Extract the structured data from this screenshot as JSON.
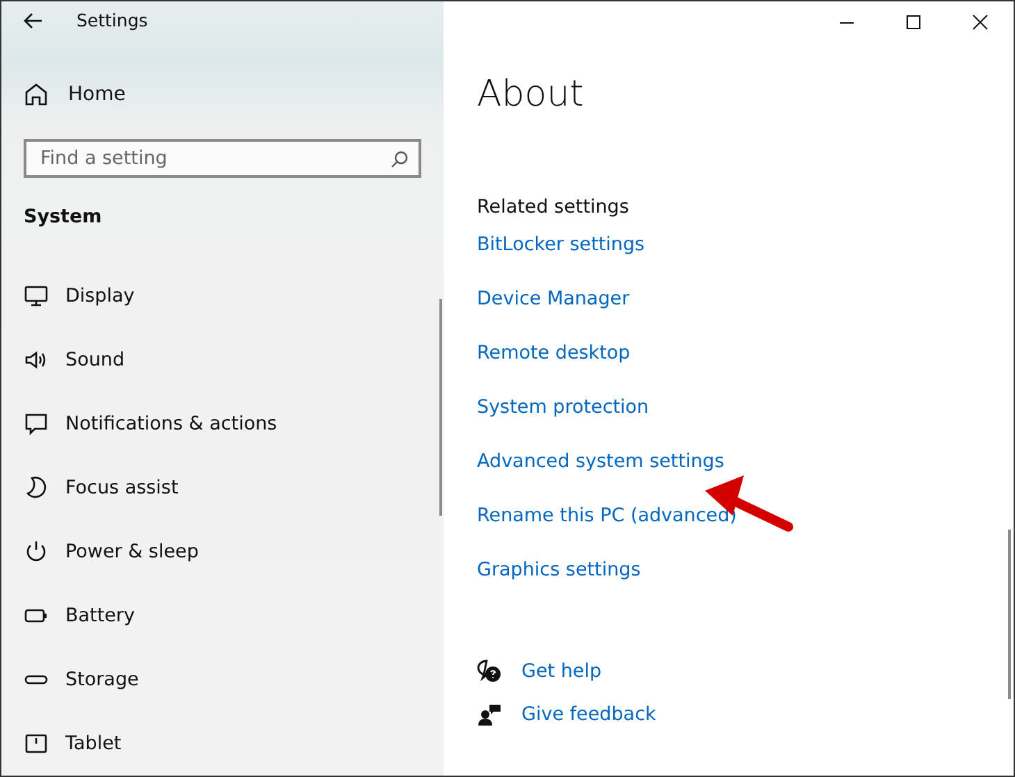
{
  "window": {
    "title": "Settings"
  },
  "sidebar": {
    "home": "Home",
    "search": {
      "placeholder": "Find a setting"
    },
    "section": "System",
    "items": [
      {
        "kind": "display",
        "label": "Display"
      },
      {
        "kind": "sound",
        "label": "Sound"
      },
      {
        "kind": "notifications",
        "label": "Notifications & actions"
      },
      {
        "kind": "focus",
        "label": "Focus assist"
      },
      {
        "kind": "power",
        "label": "Power & sleep"
      },
      {
        "kind": "battery",
        "label": "Battery"
      },
      {
        "kind": "storage",
        "label": "Storage"
      },
      {
        "kind": "tablet",
        "label": "Tablet"
      }
    ]
  },
  "content": {
    "title": "About",
    "related_heading": "Related settings",
    "links": [
      "BitLocker settings",
      "Device Manager",
      "Remote desktop",
      "System protection",
      "Advanced system settings",
      "Rename this PC (advanced)",
      "Graphics settings"
    ],
    "help_links": [
      {
        "kind": "help",
        "label": "Get help"
      },
      {
        "kind": "feedback",
        "label": "Give feedback"
      }
    ]
  }
}
